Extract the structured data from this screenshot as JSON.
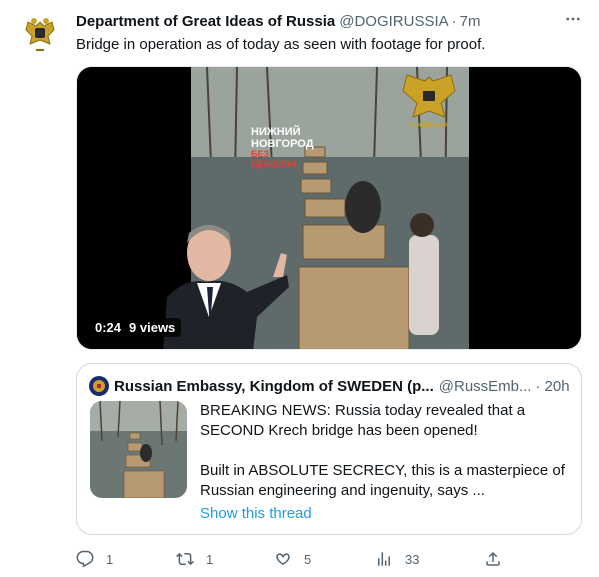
{
  "tweet": {
    "author_name": "Department of Great Ideas of Russia",
    "author_handle": "@DOGIRUSSIA",
    "separator": "·",
    "time": "7m",
    "text": "Bridge in operation as of today as seen with footage for proof."
  },
  "media": {
    "duration": "0:24",
    "views": "9 views",
    "watermark_line1": "НИЖНИЙ",
    "watermark_line2": "НОВГОРОД",
    "watermark_line3": "БЕЗ",
    "watermark_line4": "ЦЕНЗУРЫ",
    "logo_text": "DOGIRUSSIA"
  },
  "quote": {
    "author_name": "Russian Embassy, Kingdom of SWEDEN (p...",
    "author_handle": "@RussEmb...",
    "separator": "·",
    "time": "20h",
    "paragraph1": "BREAKING NEWS: Russia today revealed that a SECOND Krech bridge has been opened!",
    "paragraph2": "Built in ABSOLUTE SECRECY, this is a masterpiece of Russian engineering and ingenuity, says  ...",
    "show_thread": "Show this thread"
  },
  "actions": {
    "replies": "1",
    "retweets": "1",
    "likes": "5",
    "views": "33"
  },
  "icons": {
    "reply": "reply-icon",
    "retweet": "retweet-icon",
    "like": "heart-icon",
    "analytics": "analytics-icon",
    "share": "share-icon",
    "more": "more-icon"
  },
  "colors": {
    "text": "#0f1419",
    "secondary": "#536471",
    "link": "#1d9bf0",
    "border": "#cfd9de"
  }
}
